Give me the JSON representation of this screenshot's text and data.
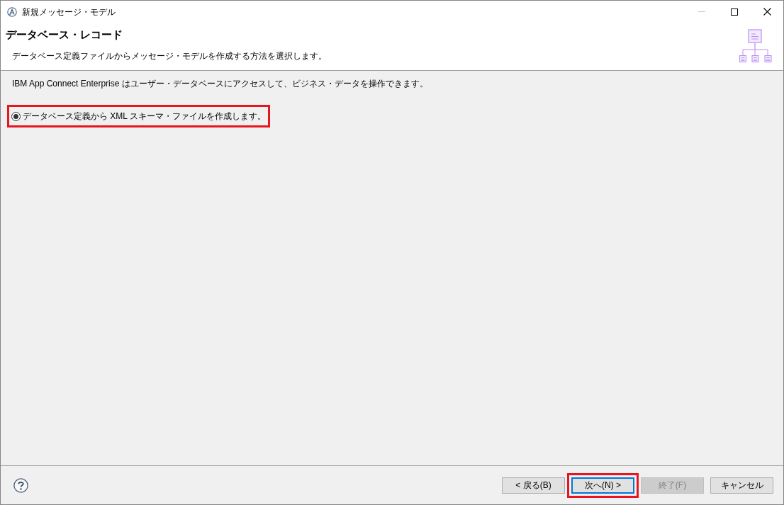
{
  "window": {
    "title": "新規メッセージ・モデル",
    "minimize_disabled": true
  },
  "header": {
    "title": "データベース・レコード",
    "description": "データベース定義ファイルからメッセージ・モデルを作成する方法を選択します。"
  },
  "body": {
    "intro": "IBM App Connect Enterprise はユーザー・データベースにアクセスして、ビジネス・データを操作できます。",
    "options": [
      {
        "label": "データベース定義から XML スキーマ・ファイルを作成します。",
        "selected": true,
        "highlighted": true
      }
    ]
  },
  "buttons": [
    {
      "label": "< 戻る(B)",
      "disabled": false,
      "default": false,
      "highlighted": false
    },
    {
      "label": "次へ(N) >",
      "disabled": false,
      "default": true,
      "highlighted": true
    },
    {
      "label": "終了(F)",
      "disabled": true,
      "default": false,
      "highlighted": false
    },
    {
      "label": "キャンセル",
      "disabled": false,
      "default": false,
      "highlighted": false
    }
  ]
}
